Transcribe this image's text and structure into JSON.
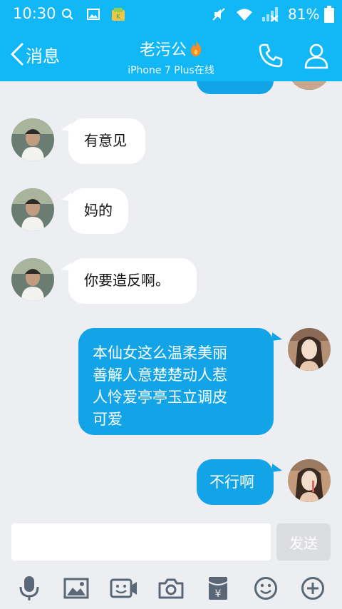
{
  "status_bar": {
    "time": "10:30",
    "battery": "81%"
  },
  "header": {
    "back_label": "消息",
    "title": "老污公",
    "subtitle": "iPhone 7 Plus在线"
  },
  "messages": [
    {
      "from": "contact",
      "text": "有意见"
    },
    {
      "from": "contact",
      "text": "妈的"
    },
    {
      "from": "contact",
      "text": "你要造反啊。"
    },
    {
      "from": "self",
      "lines": [
        "本仙女这么温柔美丽",
        "善解人意楚楚动人惹",
        "人怜爱亭亭玉立调皮",
        "可爱"
      ]
    },
    {
      "from": "self",
      "text": "不行啊"
    }
  ],
  "composer": {
    "input_value": "",
    "send_label": "发送"
  },
  "toolbar": [
    "mic-icon",
    "image-icon",
    "video-icon",
    "camera-icon",
    "red-packet-icon",
    "emoji-icon",
    "plus-icon"
  ],
  "colors": {
    "brand": "#12b7f5",
    "outgoing_bubble": "#12a4e6",
    "chat_bg": "#eceef2",
    "send_disabled": "#dcdde1"
  }
}
